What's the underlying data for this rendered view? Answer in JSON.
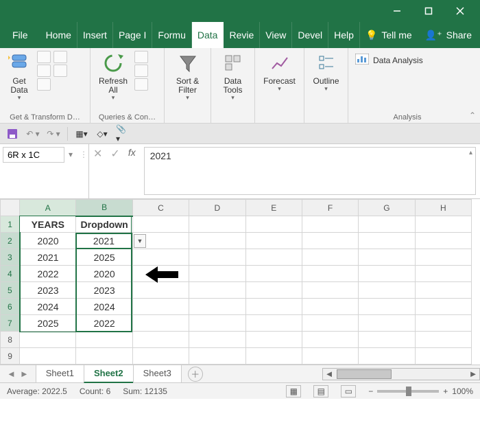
{
  "window": {
    "minimize": "—",
    "maximize": "▢",
    "close": "✕"
  },
  "menu": {
    "file": "File",
    "tabs": [
      "Home",
      "Insert",
      "Page I",
      "Formu",
      "Data",
      "Revie",
      "View",
      "Devel",
      "Help"
    ],
    "active_index": 4,
    "tellme": "Tell me",
    "share": "Share"
  },
  "ribbon": {
    "groups": {
      "get_transform": {
        "label": "Get & Transform D…",
        "get_data": "Get\nData"
      },
      "queries": {
        "label": "Queries & Con…",
        "refresh": "Refresh\nAll"
      },
      "sort_filter": {
        "label": "",
        "sort": "Sort &\nFilter"
      },
      "data_tools": {
        "label": "",
        "tools": "Data\nTools"
      },
      "forecast": {
        "label": "",
        "forecast": "Forecast"
      },
      "outline": {
        "label": "",
        "outline": "Outline"
      },
      "analysis": {
        "label": "Analysis",
        "data_analysis": "Data Analysis"
      }
    }
  },
  "namebox": {
    "value": "6R x 1C"
  },
  "formula": {
    "value": "2021"
  },
  "sheet": {
    "cols": [
      "A",
      "B",
      "C",
      "D",
      "E",
      "F",
      "G",
      "H"
    ],
    "rows": [
      "1",
      "2",
      "3",
      "4",
      "5",
      "6",
      "7",
      "8",
      "9"
    ],
    "header": {
      "A": "YEARS",
      "B": "Dropdown"
    },
    "colA": [
      "2020",
      "2021",
      "2022",
      "2023",
      "2024",
      "2025"
    ],
    "colB": [
      "2021",
      "2025",
      "2020",
      "2023",
      "2024",
      "2022"
    ],
    "active_value": "2021"
  },
  "tabs": {
    "sheets": [
      "Sheet1",
      "Sheet2",
      "Sheet3"
    ],
    "active_index": 1
  },
  "status": {
    "average_label": "Average:",
    "average": "2022.5",
    "count_label": "Count:",
    "count": "6",
    "sum_label": "Sum:",
    "sum": "12135",
    "zoom": "100%"
  },
  "chart_data": {
    "type": "table",
    "title": "",
    "columns": [
      "YEARS",
      "Dropdown"
    ],
    "rows": [
      [
        2020,
        2021
      ],
      [
        2021,
        2025
      ],
      [
        2022,
        2020
      ],
      [
        2023,
        2023
      ],
      [
        2024,
        2024
      ],
      [
        2025,
        2022
      ]
    ],
    "selection": {
      "range": "B2:B7",
      "active": "B2",
      "summary": {
        "average": 2022.5,
        "count": 6,
        "sum": 12135
      }
    }
  }
}
